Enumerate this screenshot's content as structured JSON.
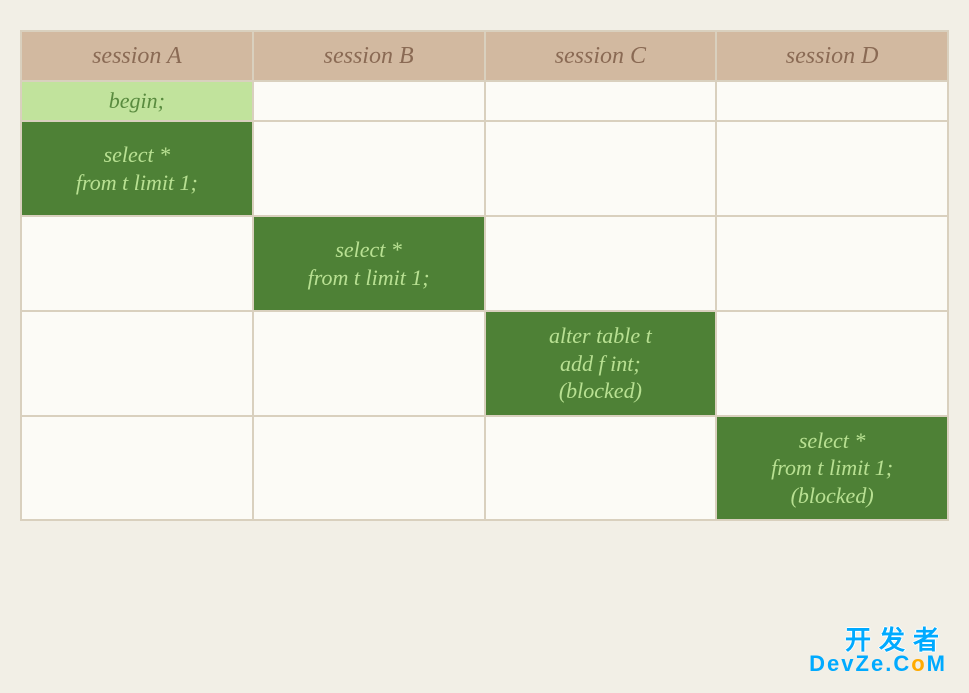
{
  "headers": [
    "session A",
    "session B",
    "session C",
    "session D"
  ],
  "rows": [
    {
      "cells": [
        {
          "type": "begin",
          "lines": [
            "begin;"
          ]
        },
        {
          "type": "empty"
        },
        {
          "type": "empty"
        },
        {
          "type": "empty"
        }
      ]
    },
    {
      "cells": [
        {
          "type": "dark",
          "lines": [
            "select *",
            "from t limit 1;"
          ]
        },
        {
          "type": "empty"
        },
        {
          "type": "empty"
        },
        {
          "type": "empty"
        }
      ]
    },
    {
      "cells": [
        {
          "type": "empty"
        },
        {
          "type": "dark",
          "lines": [
            "select *",
            "from t limit 1;"
          ]
        },
        {
          "type": "empty"
        },
        {
          "type": "empty"
        }
      ]
    },
    {
      "cells": [
        {
          "type": "empty"
        },
        {
          "type": "empty"
        },
        {
          "type": "dark",
          "lines": [
            "alter table t",
            "add f int;",
            "(blocked)"
          ]
        },
        {
          "type": "empty"
        }
      ]
    },
    {
      "cells": [
        {
          "type": "empty"
        },
        {
          "type": "empty"
        },
        {
          "type": "empty"
        },
        {
          "type": "dark",
          "lines": [
            "select *",
            "from t limit 1;",
            "(blocked)"
          ]
        }
      ]
    }
  ],
  "watermark": {
    "top": "开发者",
    "bot_pre": "DevZe.C",
    "bot_o": "o",
    "bot_post": "M"
  }
}
